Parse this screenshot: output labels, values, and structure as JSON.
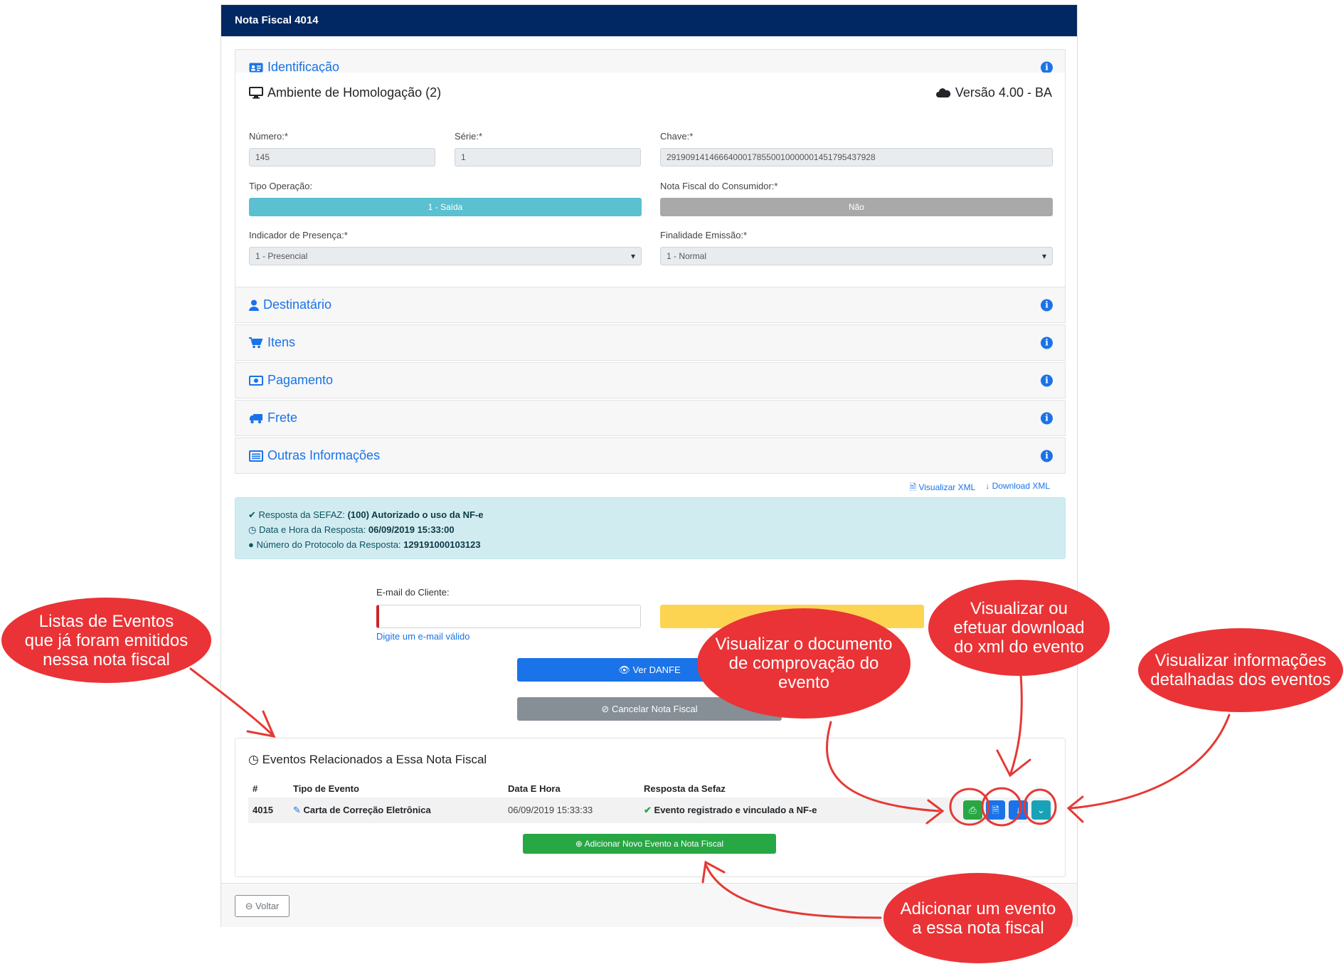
{
  "header": {
    "title": "Nota Fiscal 4014"
  },
  "sections": {
    "identificacao": "Identificação",
    "destinatario": "Destinatário",
    "itens": "Itens",
    "pagamento": "Pagamento",
    "frete": "Frete",
    "outras": "Outras Informações"
  },
  "ident": {
    "ambiente": "Ambiente de Homologação (2)",
    "versao": "Versão 4.00 - BA",
    "numero_label": "Número:*",
    "numero": "145",
    "serie_label": "Série:*",
    "serie": "1",
    "chave_label": "Chave:*",
    "chave": "29190914146664000178550010000001451795437928",
    "tipo_label": "Tipo Operação:",
    "tipo": "1 - Saída",
    "consumidor_label": "Nota Fiscal do Consumidor:*",
    "consumidor": "Não",
    "presenca_label": "Indicador de Presença:*",
    "presenca": "1 - Presencial",
    "finalidade_label": "Finalidade Emissão:*",
    "finalidade": "1 - Normal"
  },
  "xml_links": {
    "view": "Visualizar XML",
    "download": "Download XML"
  },
  "sefaz": {
    "l1_label": "Resposta da SEFAZ:",
    "l1_value": "(100) Autorizado o uso da NF-e",
    "l2_label": "Data e Hora da Resposta:",
    "l2_value": "06/09/2019 15:33:00",
    "l3_label": "Número do Protocolo da Resposta:",
    "l3_value": "129191000103123"
  },
  "email": {
    "label": "E-mail do Cliente:",
    "hint": "Digite um e-mail válido"
  },
  "buttons": {
    "danfe": "Ver DANFE",
    "cancel": "Cancelar Nota Fiscal",
    "add_event": "Adicionar Novo Evento a Nota Fiscal",
    "back": "Voltar"
  },
  "events": {
    "title": "Eventos Relacionados a Essa Nota Fiscal",
    "headers": [
      "#",
      "Tipo de Evento",
      "Data E Hora",
      "Resposta da Sefaz"
    ],
    "rows": [
      {
        "id": "4015",
        "tipo": "Carta de Correção Eletrônica",
        "data": "06/09/2019 15:33:33",
        "resposta": "Evento registrado e vinculado a NF-e"
      }
    ]
  },
  "callouts": {
    "lista": [
      "Listas de Eventos",
      "que já foram emitidos",
      "nessa nota fiscal"
    ],
    "documento": [
      "Visualizar o documento",
      "de comprovação do",
      "evento"
    ],
    "xml": [
      "Visualizar ou",
      "efetuar download",
      "do xml do evento"
    ],
    "detalhes": [
      "Visualizar informações",
      "detalhadas dos eventos"
    ],
    "adicionar": [
      "Adicionar um evento",
      "a essa nota fiscal"
    ]
  },
  "colors": {
    "navy": "#012862",
    "blue": "#1a73e8",
    "teal": "#5bc0cf",
    "green": "#28a745",
    "gray": "#868e96",
    "yellow": "#fdd451",
    "red": "#ea3336"
  }
}
